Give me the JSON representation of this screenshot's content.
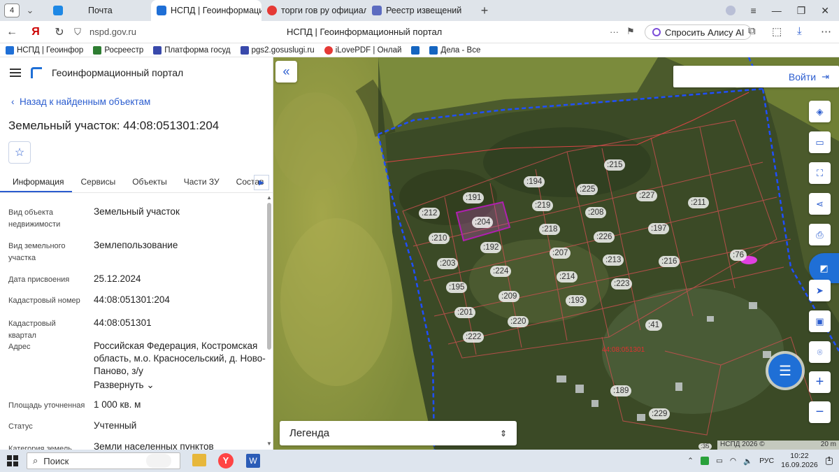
{
  "browser": {
    "tab_count": "4",
    "tabs": [
      {
        "label": "Почта",
        "color": "#1e88e5"
      },
      {
        "label": "НСПД | Геоинформаци",
        "color": "#1f6fd6",
        "active": true
      },
      {
        "label": "торги гов ру официальн",
        "color": "#e53935"
      },
      {
        "label": "Реестр извещений",
        "color": "#5c6bc0"
      }
    ],
    "url": "nspd.gov.ru",
    "page_title": "НСПД | Геоинформационный портал",
    "alice_label": "Спросить Алису AI",
    "bookmarks": [
      {
        "label": "НСПД | Геоинфор",
        "color": "#1f6fd6"
      },
      {
        "label": "Росреестр",
        "color": "#2e7d32"
      },
      {
        "label": "Платформа госуд",
        "color": "#3949ab"
      },
      {
        "label": "pgs2.gosuslugi.ru",
        "color": "#3949ab"
      },
      {
        "label": "iLovePDF | Онлай",
        "color": "#e53935"
      },
      {
        "label": "",
        "color": "#1565c0"
      },
      {
        "label": "Дела - Все",
        "color": "#1565c0"
      }
    ]
  },
  "panel": {
    "portal_name": "Геоинформационный портал",
    "back_link": "Назад к найденным объектам",
    "title": "Земельный участок: 44:08:051301:204",
    "tabs": [
      "Информация",
      "Сервисы",
      "Объекты",
      "Части ЗУ",
      "Состав"
    ],
    "rows": [
      {
        "key": "Вид объекта недвижимости",
        "value": "Земельный участок"
      },
      {
        "key": "Вид земельного участка",
        "value": "Землепользование"
      },
      {
        "key": "Дата присвоения",
        "value": "25.12.2024"
      },
      {
        "key": "Кадастровый номер",
        "value": "44:08:051301:204"
      },
      {
        "key": "Кадастровый квартал",
        "value": "44:08:051301"
      },
      {
        "key": "Адрес",
        "value": "Российская Федерация, Костромская область, м.о. Красносельский, д. Ново-Паново, з/у"
      },
      {
        "key": "Площадь уточненная",
        "value": "1 000 кв. м"
      },
      {
        "key": "Статус",
        "value": "Учтенный"
      },
      {
        "key": "Категория земель",
        "value": "Земли населенных пунктов"
      }
    ],
    "expand_label": "Развернуть"
  },
  "map": {
    "login_label": "Войти",
    "legend_label": "Легенда",
    "quarter_label": "44:08:051301",
    "attribution": "НСПД 2026 ©",
    "scale_label": "20 m",
    "parcels": [
      ":215",
      ":194",
      ":225",
      ":191",
      ":227",
      ":211",
      ":212",
      ":204",
      ":219",
      ":208",
      ":218",
      ":197",
      ":210",
      ":192",
      ":226",
      ":76",
      ":203",
      ":207",
      ":213",
      ":216",
      ":224",
      ":195",
      ":214",
      ":223",
      ":209",
      ":193",
      ":201",
      ":220",
      ":41",
      ":222",
      ":189",
      ":229",
      ":35"
    ]
  },
  "taskbar": {
    "search_label": "Поиск",
    "lang": "РУС",
    "time": "10:22",
    "date": "16.09.2026",
    "notif": "1"
  }
}
